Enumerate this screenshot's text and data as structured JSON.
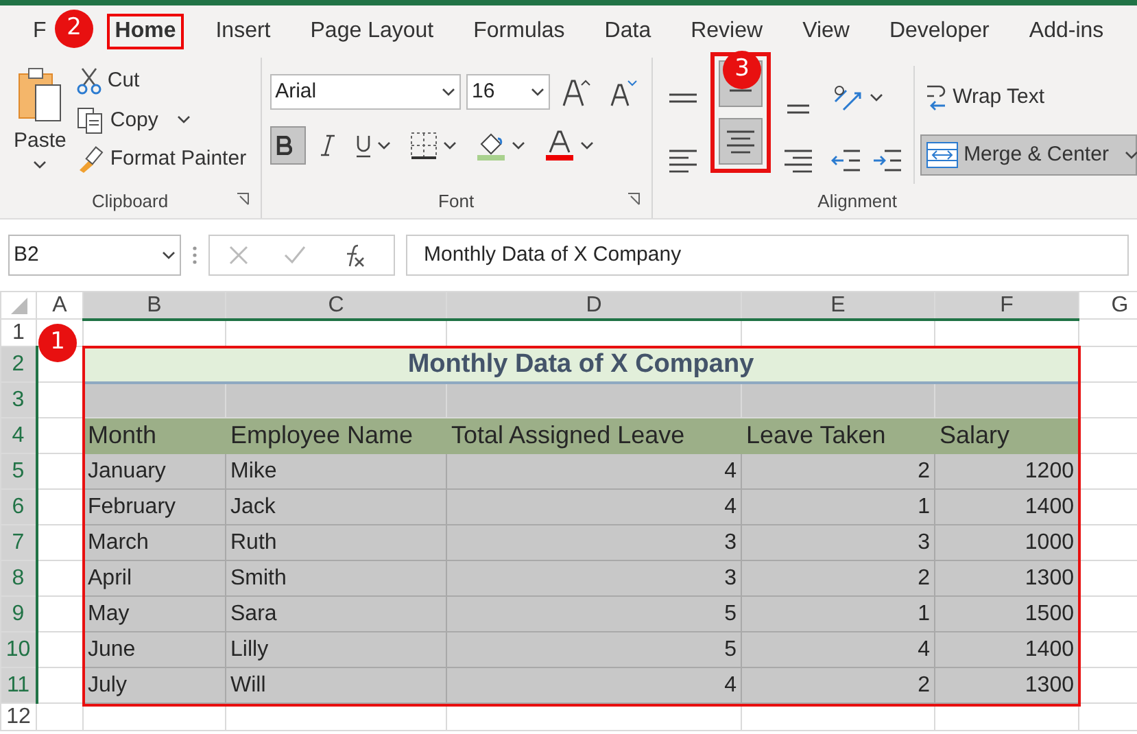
{
  "tabs": [
    {
      "label": "F",
      "selected": false
    },
    {
      "label": "Home",
      "selected": true
    },
    {
      "label": "Insert",
      "selected": false
    },
    {
      "label": "Page Layout",
      "selected": false
    },
    {
      "label": "Formulas",
      "selected": false
    },
    {
      "label": "Data",
      "selected": false
    },
    {
      "label": "Review",
      "selected": false
    },
    {
      "label": "View",
      "selected": false
    },
    {
      "label": "Developer",
      "selected": false
    },
    {
      "label": "Add-ins",
      "selected": false
    }
  ],
  "clipboard": {
    "label": "Clipboard",
    "paste": "Paste",
    "cut": "Cut",
    "copy": "Copy",
    "format_painter": "Format Painter"
  },
  "font": {
    "label": "Font",
    "name": "Arial",
    "size": "16",
    "bold_pressed": true
  },
  "alignment": {
    "label": "Alignment",
    "middle_align_pressed": true,
    "center_pressed": true,
    "wrap_text": "Wrap Text",
    "merge": "Merge & Center",
    "merge_pressed": true
  },
  "name_box": "B2",
  "formula": "Monthly Data of X Company",
  "columns": [
    {
      "label": "A",
      "selected": false
    },
    {
      "label": "B",
      "selected": true
    },
    {
      "label": "C",
      "selected": true
    },
    {
      "label": "D",
      "selected": true
    },
    {
      "label": "E",
      "selected": true
    },
    {
      "label": "F",
      "selected": true
    },
    {
      "label": "G",
      "selected": false
    }
  ],
  "rows": [
    {
      "number": "1",
      "kind": "blank",
      "selected": false
    },
    {
      "number": "2",
      "kind": "title",
      "selected": true,
      "cells": [
        "Monthly Data of X Company"
      ]
    },
    {
      "number": "3",
      "kind": "empty-fill",
      "selected": true
    },
    {
      "number": "4",
      "kind": "header",
      "selected": true,
      "cells": [
        "Month",
        "Employee Name",
        "Total Assigned Leave",
        "Leave Taken",
        "Salary"
      ]
    },
    {
      "number": "5",
      "kind": "data",
      "selected": true,
      "cells": [
        "January",
        "Mike",
        "4",
        "2",
        "1200"
      ]
    },
    {
      "number": "6",
      "kind": "data",
      "selected": true,
      "cells": [
        "February",
        "Jack",
        "4",
        "1",
        "1400"
      ]
    },
    {
      "number": "7",
      "kind": "data",
      "selected": true,
      "cells": [
        "March",
        "Ruth",
        "3",
        "3",
        "1000"
      ]
    },
    {
      "number": "8",
      "kind": "data",
      "selected": true,
      "cells": [
        "April",
        "Smith",
        "3",
        "2",
        "1300"
      ]
    },
    {
      "number": "9",
      "kind": "data",
      "selected": true,
      "cells": [
        "May",
        "Sara",
        "5",
        "1",
        "1500"
      ]
    },
    {
      "number": "10",
      "kind": "data",
      "selected": true,
      "cells": [
        "June",
        "Lilly",
        "5",
        "4",
        "1400"
      ]
    },
    {
      "number": "11",
      "kind": "data",
      "selected": true,
      "cells": [
        "July",
        "Will",
        "4",
        "2",
        "1300"
      ]
    },
    {
      "number": "12",
      "kind": "blank",
      "selected": false
    }
  ],
  "callouts": [
    {
      "label": "1"
    },
    {
      "label": "2"
    },
    {
      "label": "3"
    }
  ]
}
